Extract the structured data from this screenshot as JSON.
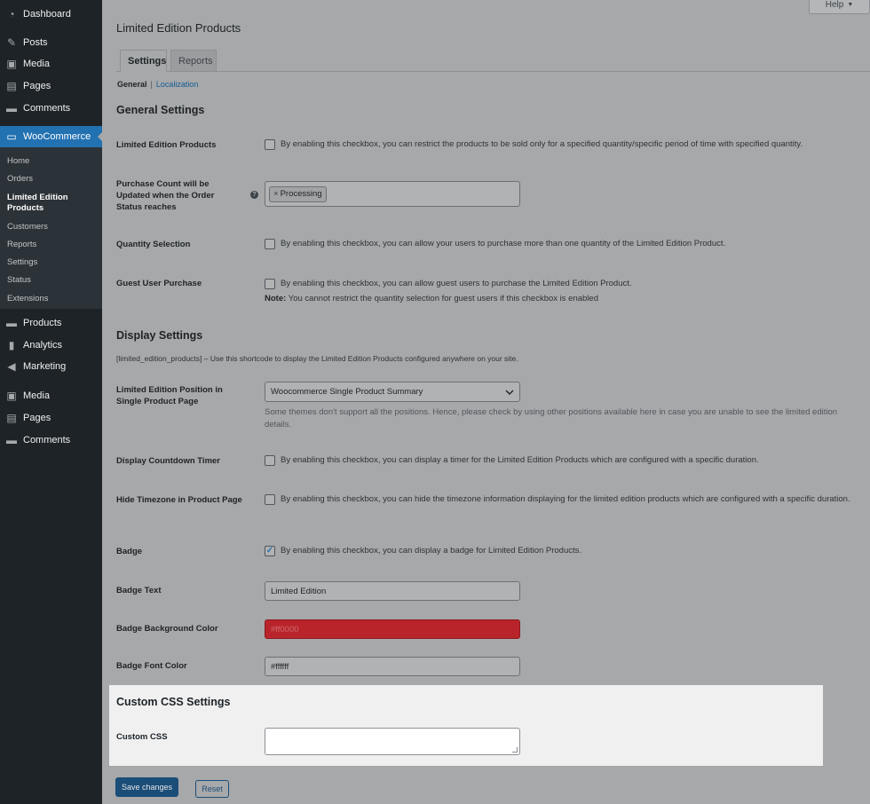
{
  "sidebar": {
    "top_items": [
      {
        "label": "Dashboard",
        "icon": "dashboard-icon"
      },
      {
        "label": "Posts",
        "icon": "pin-icon"
      },
      {
        "label": "Media",
        "icon": "media-icon"
      },
      {
        "label": "Pages",
        "icon": "page-icon"
      },
      {
        "label": "Comments",
        "icon": "comment-icon"
      },
      {
        "label": "WooCommerce",
        "icon": "woo-icon"
      }
    ],
    "submenu": [
      "Home",
      "Orders",
      "Limited Edition Products",
      "Customers",
      "Reports",
      "Settings",
      "Status",
      "Extensions"
    ],
    "bottom_items": [
      {
        "label": "Products",
        "icon": "products-icon"
      },
      {
        "label": "Analytics",
        "icon": "analytics-icon"
      },
      {
        "label": "Marketing",
        "icon": "megaphone-icon"
      },
      {
        "label": "Media",
        "icon": "media-icon"
      },
      {
        "label": "Pages",
        "icon": "page-icon"
      },
      {
        "label": "Comments",
        "icon": "comment-icon"
      }
    ]
  },
  "header": {
    "help_label": "Help",
    "help_caret": "▼",
    "title": "Limited Edition Products"
  },
  "tabs": [
    {
      "label": "Settings"
    },
    {
      "label": "Reports"
    }
  ],
  "subnav": {
    "current": "General",
    "separator": "|",
    "link": "Localization"
  },
  "general": {
    "title": "General Settings",
    "limited_label": "Limited Edition Products",
    "limited_text": "By enabling this checkbox, you can restrict the products to be sold only for a specified quantity/specific period of time with specified quantity.",
    "purchase_label": "Purchase Count will be Updated when the Order Status reaches",
    "purchase_help": "?",
    "purchase_chip_x": "×",
    "purchase_chip": "Processing",
    "qty_label": "Quantity Selection",
    "qty_text": "By enabling this checkbox, you can allow your users to purchase more than one quantity of the Limited Edition Product.",
    "guest_label": "Guest User Purchase",
    "guest_text": "By enabling this checkbox, you can allow guest users to purchase the Limited Edition Product.",
    "guest_note_bold": "Note:",
    "guest_note": " You cannot restrict the quantity selection for guest users if this checkbox is enabled"
  },
  "display": {
    "title": "Display Settings",
    "shortcode": "[limited_edition_products] – Use this shortcode to display the Limited Edition Products configured anywhere on your site.",
    "position_label": "Limited Edition Position in Single Product Page",
    "position_value": "Woocommerce Single Product Summary",
    "position_desc": "Some themes don't support all the positions. Hence, please check by using other positions available here in case you are unable to see the limited edition details.",
    "countdown_label": "Display Countdown Timer",
    "countdown_text": "By enabling this checkbox, you can display a timer for the Limited Edition Products which are configured with a specific duration.",
    "timezone_label": "Hide Timezone in Product Page",
    "timezone_text": "By enabling this checkbox, you can hide the timezone information displaying for the limited edition products which are configured with a specific duration.",
    "badge_label": "Badge",
    "badge_check": "✓",
    "badge_text": "By enabling this checkbox, you can display a badge for Limited Edition Products.",
    "badge_text_label": "Badge Text",
    "badge_text_value": "Limited Edition",
    "badge_bg_label": "Badge Background Color",
    "badge_bg_value": "#ff0000",
    "badge_font_label": "Badge Font Color",
    "badge_font_value": "#ffffff"
  },
  "custom_css": {
    "title": "Custom CSS Settings",
    "label": "Custom CSS"
  },
  "actions": {
    "save": "Save changes",
    "reset": "Reset"
  },
  "colors": {
    "accent": "#2271b1",
    "sidebar": "#1d2327",
    "badge_bg": "#ff0000"
  }
}
